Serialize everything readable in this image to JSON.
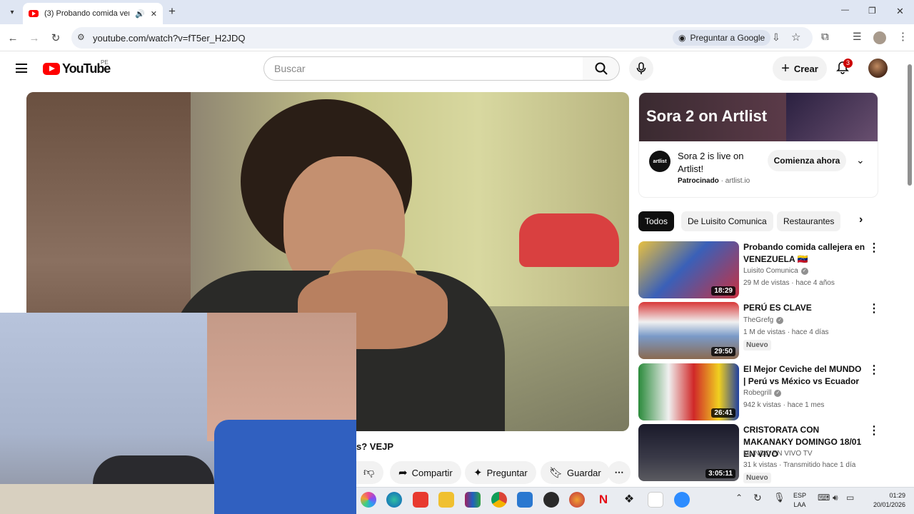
{
  "browser": {
    "tab_title": "(3) Probando comida vene",
    "url": "youtube.com/watch?v=fT5er_H2JDQ",
    "ask_google": "Preguntar a Google",
    "new_tab": "+",
    "tab_close": "✕",
    "window_min": "—",
    "window_max": "❐",
    "window_close": "✕"
  },
  "youtube": {
    "logo_text": "YouTube",
    "region": "PE",
    "search_placeholder": "Buscar",
    "create_label": "Crear",
    "notif_count": "3"
  },
  "ad": {
    "banner_text": "Sora 2 on Artlist",
    "logo": "artlist",
    "title": "Sora 2 is live on Artlist!",
    "sponsored": "Patrocinado",
    "domain": "artlist.io",
    "cta": "Comienza ahora"
  },
  "chips": [
    "Todos",
    "De Luisito Comunica",
    "Restaurantes"
  ],
  "recommendations": [
    {
      "title": "Probando comida callejera en VENEZUELA 🇻🇪",
      "channel": "Luisito Comunica",
      "verified": true,
      "meta": "29 M de vistas · hace 4 años",
      "duration": "18:29",
      "badge": ""
    },
    {
      "title": "PERÚ ES CLAVE",
      "channel": "TheGrefg",
      "verified": true,
      "meta": "1 M de vistas · hace 4 días",
      "duration": "29:50",
      "badge": "Nuevo"
    },
    {
      "title": "El Mejor Ceviche del MUNDO | Perú vs México vs Ecuador",
      "channel": "Robegrill",
      "verified": true,
      "meta": "942 k vistas · hace 1 mes",
      "duration": "26:41",
      "badge": ""
    },
    {
      "title": "CRISTORATA CON MAKANAKY DOMINGO 18/01 EN VIVO",
      "channel": "MUNDO EN VIVO TV",
      "verified": false,
      "meta": "31 k vistas · Transmitido hace 1 día",
      "duration": "3:05:11",
      "badge": "Nuevo"
    }
  ],
  "video": {
    "title_fragment": "s? VEJP"
  },
  "actions": {
    "share": "Compartir",
    "ask": "Preguntar",
    "save": "Guardar"
  },
  "taskbar": {
    "lang_top": "ESP",
    "lang_bottom": "LAA",
    "time": "01:29",
    "date": "20/01/2026"
  }
}
